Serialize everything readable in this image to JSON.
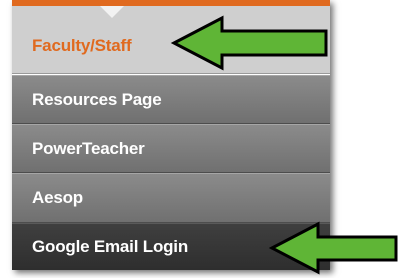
{
  "menu": {
    "items": [
      {
        "label": "Faculty/Staff"
      },
      {
        "label": "Resources Page"
      },
      {
        "label": "PowerTeacher"
      },
      {
        "label": "Aesop"
      },
      {
        "label": "Google Email Login"
      }
    ]
  },
  "colors": {
    "accent": "#e06a1f",
    "active_bg": "#cfcfcf",
    "item_bg": "#7d7d7d",
    "dark_item_bg": "#363636",
    "arrow_fill": "#5fb536",
    "arrow_stroke": "#000000"
  },
  "annotations": [
    {
      "icon": "arrow-left-icon",
      "points_to": "Faculty/Staff"
    },
    {
      "icon": "arrow-left-icon",
      "points_to": "Google Email Login"
    }
  ]
}
